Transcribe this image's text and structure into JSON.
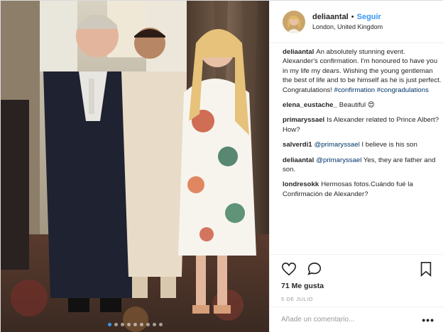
{
  "post": {
    "username": "deliaantal",
    "separator": "•",
    "follow_label": "Seguir",
    "location": "London, United Kingdom"
  },
  "comments": [
    {
      "user": "deliaantal",
      "text": "An absolutely stunning event. Alexander's confirmation. I'm honoured to have you in my life my dears. Wishing the young gentleman the best of life and to be himself as he is just perfect. Congratulations! ",
      "tags": "#confirmation #congradulations"
    },
    {
      "user": "elena_eustache_",
      "text": "Beautiful 😍",
      "mention": ""
    },
    {
      "user": "primaryssael",
      "text": "Is Alexander related to Prince Albert? How?",
      "mention": ""
    },
    {
      "user": "salverdi1",
      "mention": "@primaryssael",
      "text": " I believe is his son"
    },
    {
      "user": "deliaantal",
      "mention": "@primaryssael",
      "text": " Yes, they are father and son."
    },
    {
      "user": "londresokk",
      "text": "Hermosas fotos.Cuándo fué la Confirmación de Alexander?",
      "mention": ""
    }
  ],
  "actions": {
    "like_icon": "heart-icon",
    "comment_icon": "speech-bubble-icon",
    "save_icon": "bookmark-icon"
  },
  "likes": "71 Me gusta",
  "date": "5 DE JULIO",
  "add_comment": {
    "placeholder": "Añade un comentario...",
    "more": "•••"
  },
  "carousel": {
    "count": 9,
    "active_index": 0
  },
  "colors": {
    "accent": "#3897f0",
    "text": "#262626",
    "muted": "#999999",
    "link": "#003569"
  }
}
